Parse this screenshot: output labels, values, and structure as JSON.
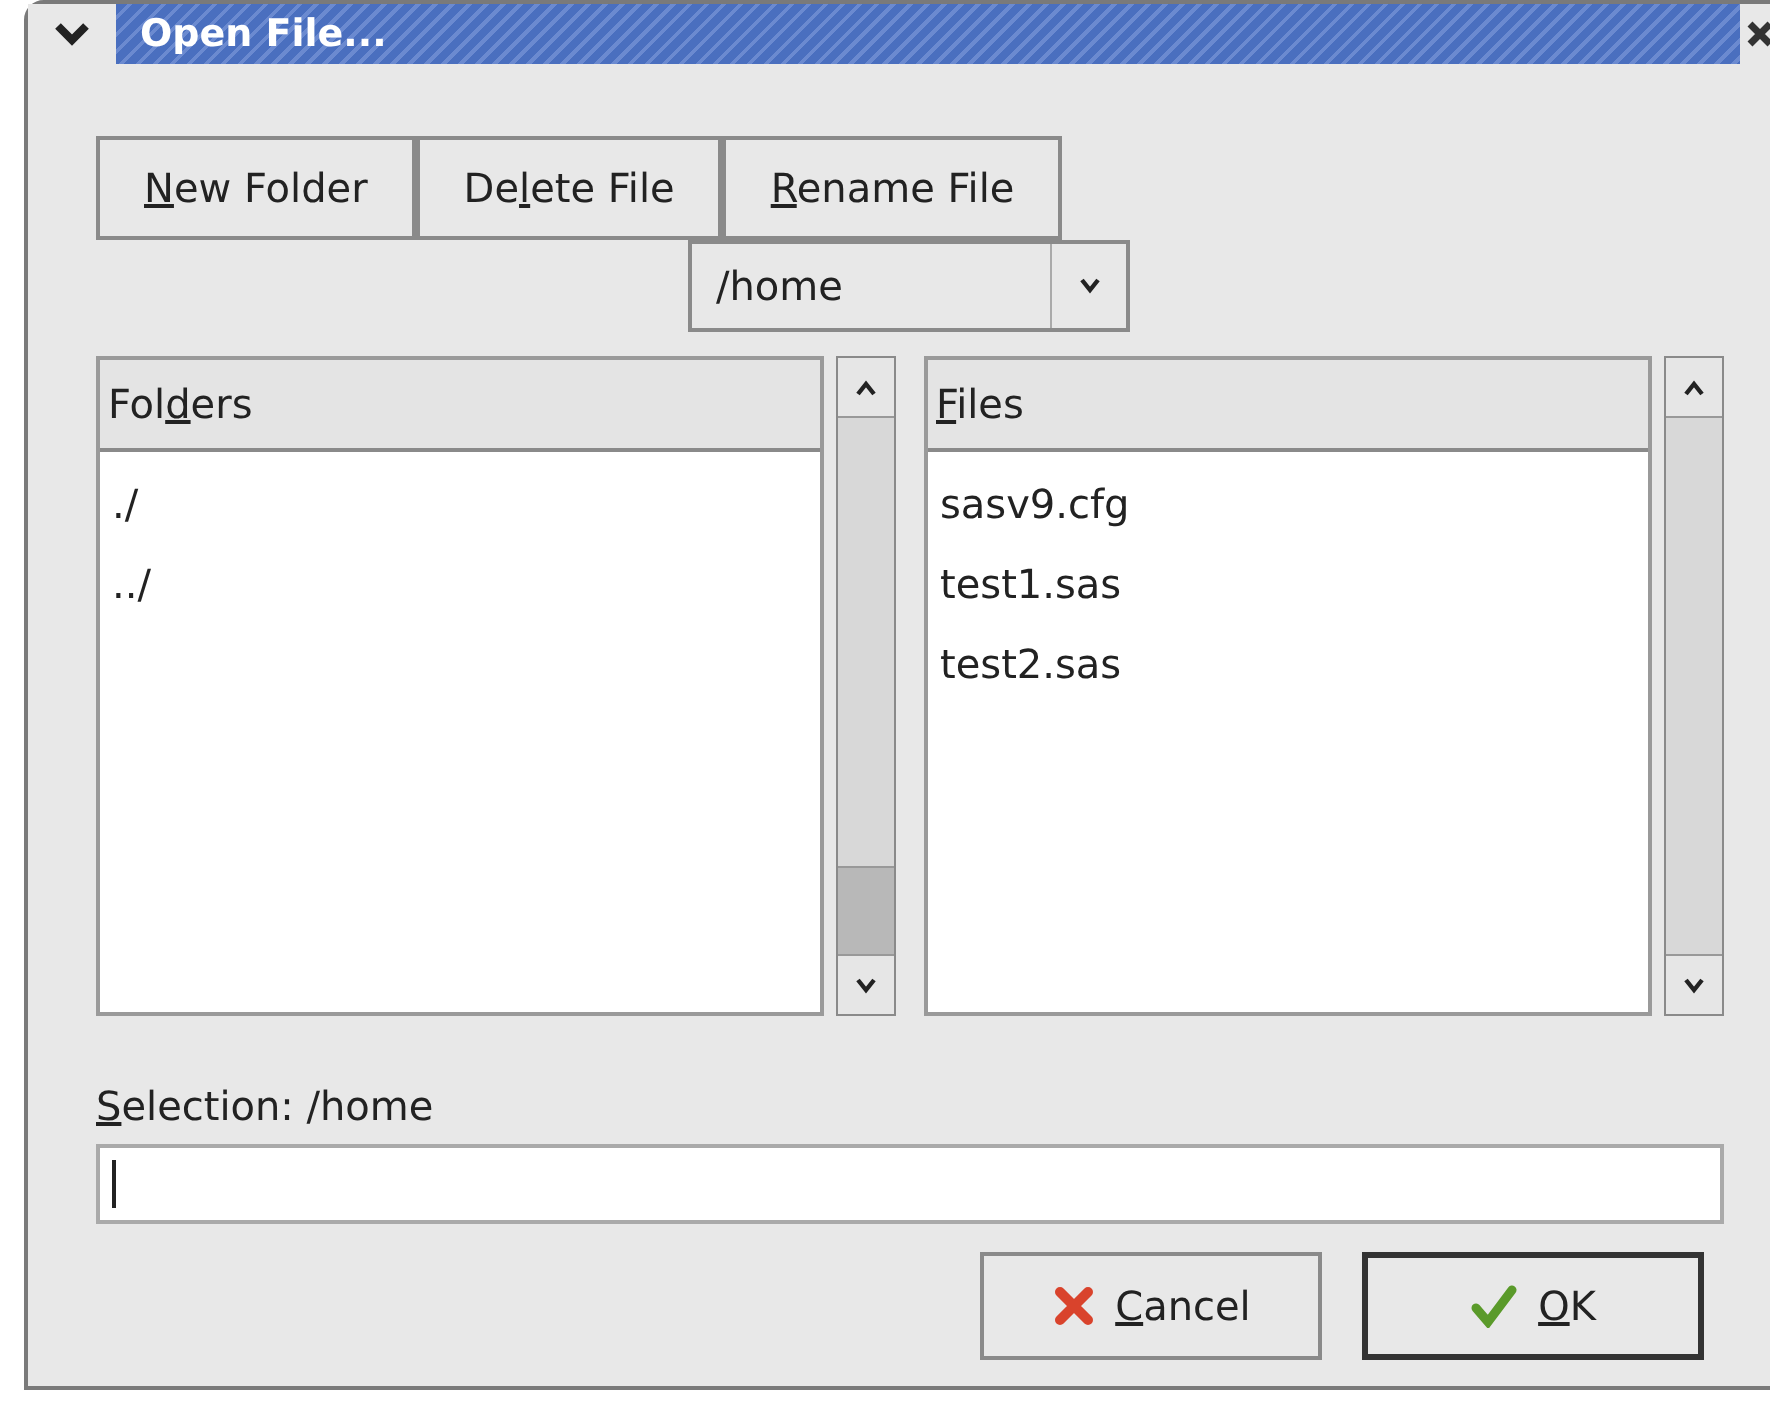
{
  "window": {
    "title": "Open File..."
  },
  "toolbar": [
    {
      "key": "N",
      "post": "ew Folder"
    },
    {
      "pre": "De",
      "key": "l",
      "post": "ete File"
    },
    {
      "key": "R",
      "post": "ename File"
    }
  ],
  "path_dropdown": {
    "value": "/home"
  },
  "folders": {
    "header": {
      "pre": "Fol",
      "key": "d",
      "post": "ers"
    },
    "items": [
      "./",
      "../"
    ]
  },
  "files": {
    "header": {
      "key": "F",
      "post": "iles"
    },
    "items": [
      "sasv9.cfg",
      "test1.sas",
      "test2.sas"
    ]
  },
  "selection": {
    "label": {
      "key": "S",
      "post": "election: /home"
    }
  },
  "buttons": [
    {
      "kind": "cancel",
      "key": "C",
      "post": "ancel",
      "default": false
    },
    {
      "kind": "ok",
      "key": "O",
      "post": "K",
      "default": true
    }
  ]
}
